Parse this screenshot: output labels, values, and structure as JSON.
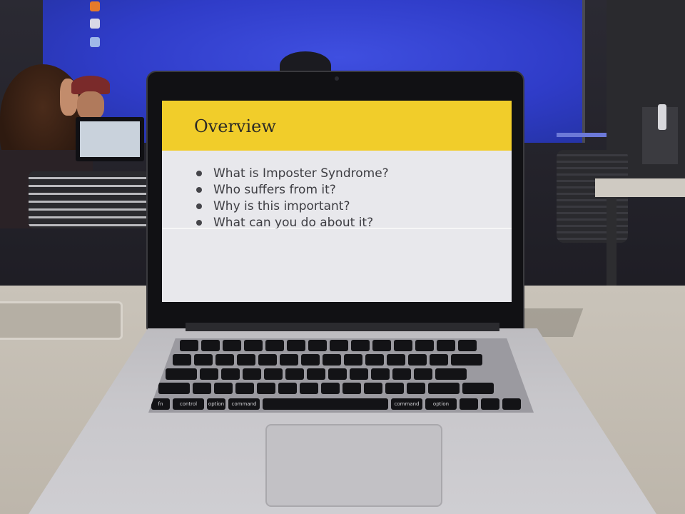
{
  "slide": {
    "title": "Overview",
    "bullets": [
      "What is Imposter Syndrome?",
      "Who suffers from it?",
      "Why is this important?",
      "What can you do about it?"
    ]
  },
  "colors": {
    "slide_header": "#f1cd2a",
    "slide_background": "#e8e8ec",
    "projection": "#3f4fe0"
  },
  "keyboard": {
    "space_row": [
      "fn",
      "control",
      "option",
      "command",
      "",
      "command",
      "option"
    ]
  }
}
